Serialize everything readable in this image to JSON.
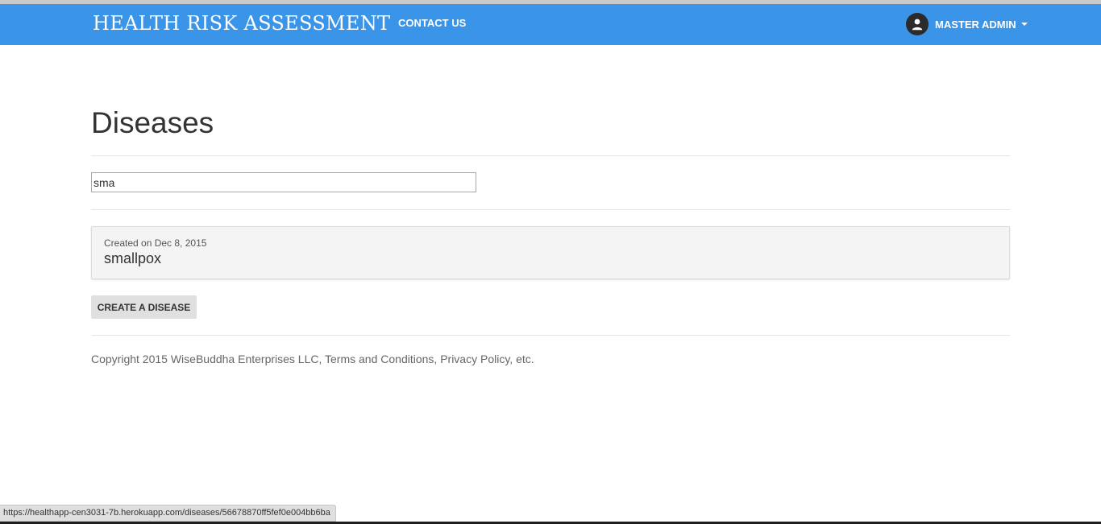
{
  "navbar": {
    "brand": "HEALTH RISK ASSESSMENT",
    "contact_label": "CONTACT US",
    "user_name": "MASTER ADMIN",
    "background_color": "#3a94e8"
  },
  "main": {
    "title": "Diseases",
    "search": {
      "value": "sma",
      "placeholder": ""
    },
    "diseases": [
      {
        "created": "Created on Dec 8, 2015",
        "name": "smallpox"
      }
    ],
    "create_label": "CREATE A DISEASE"
  },
  "footer": {
    "copyright": "Copyright 2015 WiseBuddha Enterprises LLC, Terms and Conditions, Privacy Policy, etc."
  },
  "status_bar": {
    "url": "https://healthapp-cen3031-7b.herokuapp.com/diseases/56678870ff5fef0e004bb6ba"
  },
  "icons": {
    "user": "user-avatar-icon",
    "dropdown": "caret-down-icon"
  }
}
